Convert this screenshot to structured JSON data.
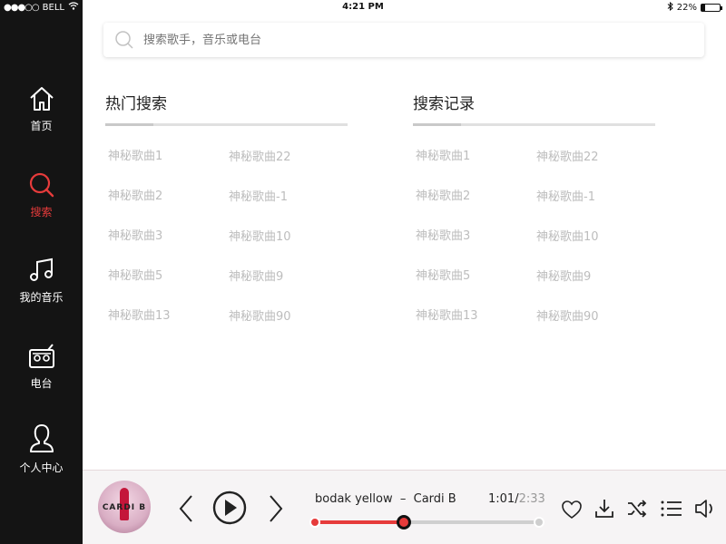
{
  "status": {
    "carrier": "BELL",
    "time": "4:21 PM",
    "battery": "22%",
    "battery_level": 0.22
  },
  "sidebar": {
    "items": [
      {
        "label": "首页",
        "icon": "home-icon"
      },
      {
        "label": "搜索",
        "icon": "search-icon",
        "active": true
      },
      {
        "label": "我的音乐",
        "icon": "music-note-icon"
      },
      {
        "label": "电台",
        "icon": "radio-icon"
      },
      {
        "label": "个人中心",
        "icon": "user-icon"
      }
    ]
  },
  "search": {
    "placeholder": "搜索歌手，音乐或电台"
  },
  "hot": {
    "title": "热门搜索",
    "col1": [
      "神秘歌曲1",
      "神秘歌曲2",
      "神秘歌曲3",
      "神秘歌曲5",
      "神秘歌曲13"
    ],
    "col2": [
      "神秘歌曲22",
      "神秘歌曲-1",
      "神秘歌曲10",
      "神秘歌曲9",
      "神秘歌曲90"
    ]
  },
  "history": {
    "title": "搜索记录",
    "col1": [
      "神秘歌曲1",
      "神秘歌曲2",
      "神秘歌曲3",
      "神秘歌曲5",
      "神秘歌曲13"
    ],
    "col2": [
      "神秘歌曲22",
      "神秘歌曲-1",
      "神秘歌曲10",
      "神秘歌曲9",
      "神秘歌曲90"
    ]
  },
  "player": {
    "cover_text": "CARDI B",
    "song_title": "bodak yellow",
    "separator": "–",
    "artist": "Cardi B",
    "current_time": "1:01",
    "total_time": "2:33",
    "progress": 0.4
  },
  "colors": {
    "accent": "#e63b3b",
    "sidebar_bg": "#141414",
    "tag_text": "#bdbdbd"
  }
}
